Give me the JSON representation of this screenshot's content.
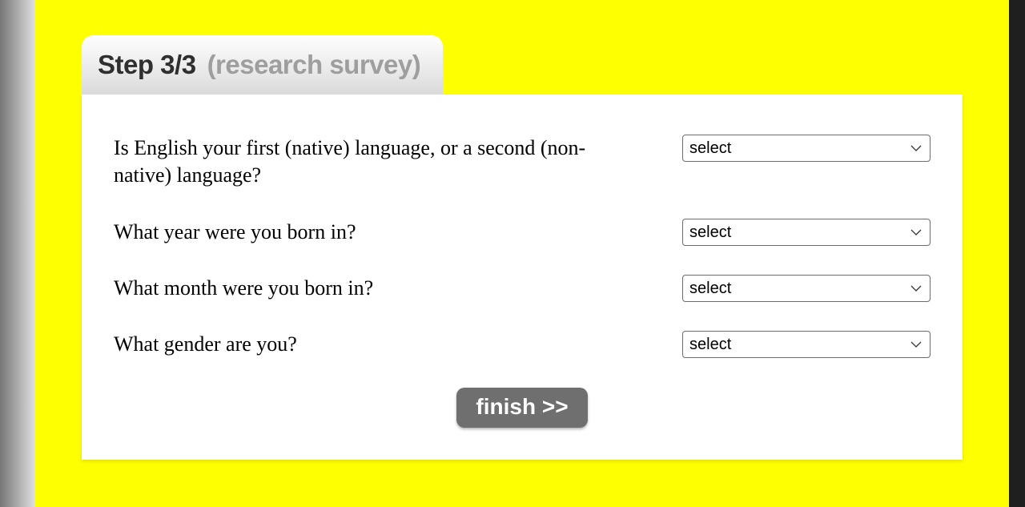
{
  "header": {
    "step_label": "Step 3/3",
    "step_subtitle": "(research survey)"
  },
  "questions": [
    {
      "text": "Is English your first (native) language, or a second (non-native) language?",
      "selected": "select"
    },
    {
      "text": "What year were you born in?",
      "selected": "select"
    },
    {
      "text": "What month were you born in?",
      "selected": "select"
    },
    {
      "text": "What gender are you?",
      "selected": "select"
    }
  ],
  "finish_label": "finish >>"
}
